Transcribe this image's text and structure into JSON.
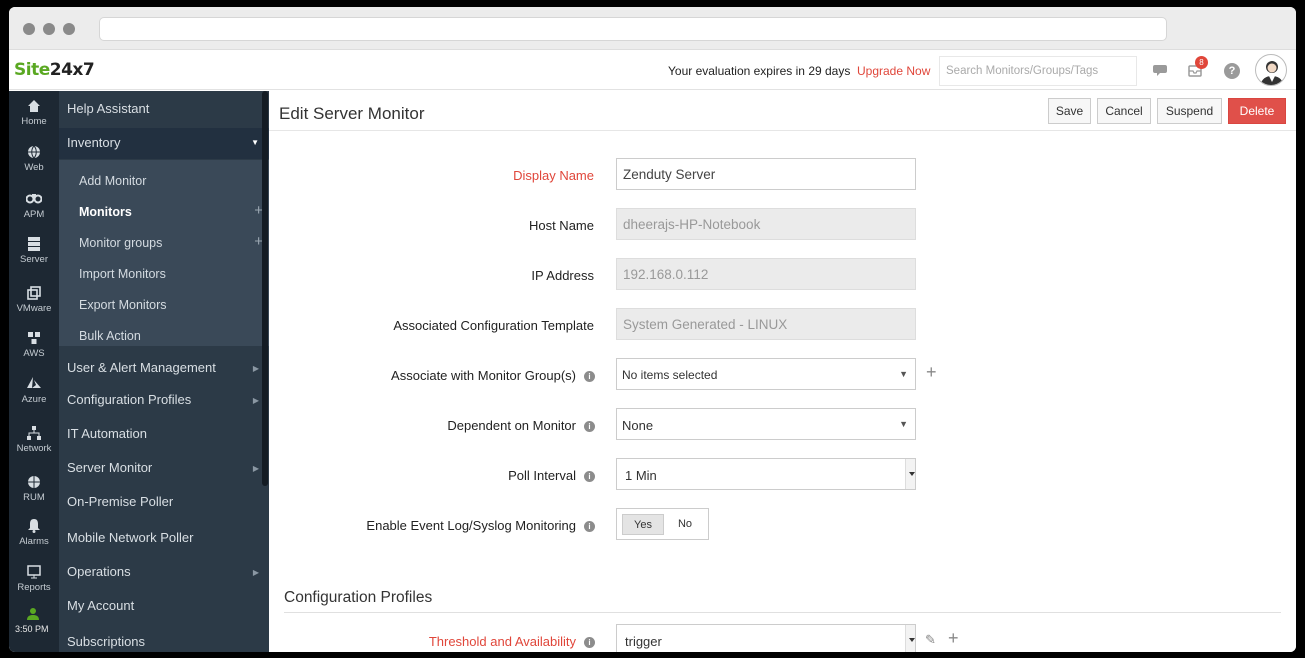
{
  "browser": {
    "url": ""
  },
  "topbar": {
    "logo_site": "Site",
    "logo_num": "24x7",
    "evaluation_text": "Your evaluation expires in 29 days",
    "upgrade_label": "Upgrade Now",
    "search_placeholder": "Search Monitors/Groups/Tags",
    "notification_count": "8"
  },
  "icon_nav": [
    {
      "label": "Home",
      "icon": "home-icon"
    },
    {
      "label": "Web",
      "icon": "globe-icon"
    },
    {
      "label": "APM",
      "icon": "binoculars-icon"
    },
    {
      "label": "Server",
      "icon": "server-icon"
    },
    {
      "label": "VMware",
      "icon": "vmware-icon"
    },
    {
      "label": "AWS",
      "icon": "aws-icon"
    },
    {
      "label": "Azure",
      "icon": "azure-icon"
    },
    {
      "label": "Network",
      "icon": "network-icon"
    },
    {
      "label": "RUM",
      "icon": "rum-globe-icon"
    },
    {
      "label": "Alarms",
      "icon": "bell-icon"
    },
    {
      "label": "Reports",
      "icon": "reports-icon"
    }
  ],
  "clock": "3:50 PM",
  "side_menu": {
    "help_assistant": "Help Assistant",
    "inventory": "Inventory",
    "inventory_items": [
      "Add Monitor",
      "Monitors",
      "Monitor groups",
      "Import Monitors",
      "Export Monitors",
      "Bulk Action"
    ],
    "items": [
      "User & Alert Management",
      "Configuration Profiles",
      "IT Automation",
      "Server Monitor",
      "On-Premise Poller",
      "Mobile Network Poller",
      "Operations",
      "My Account",
      "Subscriptions"
    ]
  },
  "page": {
    "title": "Edit Server Monitor",
    "buttons": {
      "save": "Save",
      "cancel": "Cancel",
      "suspend": "Suspend",
      "delete": "Delete"
    }
  },
  "form": {
    "display_name": {
      "label": "Display Name",
      "value": "Zenduty Server"
    },
    "host_name": {
      "label": "Host Name",
      "value": "dheerajs-HP-Notebook"
    },
    "ip_address": {
      "label": "IP Address",
      "value": "192.168.0.112"
    },
    "config_template": {
      "label": "Associated Configuration Template",
      "value": "System Generated - LINUX"
    },
    "monitor_group": {
      "label": "Associate with Monitor Group(s)",
      "value": "No items selected"
    },
    "dependent": {
      "label": "Dependent on Monitor",
      "value": "None"
    },
    "poll_interval": {
      "label": "Poll Interval",
      "value": "1 Min"
    },
    "event_log": {
      "label": "Enable Event Log/Syslog Monitoring",
      "yes": "Yes",
      "no": "No",
      "selected": "Yes"
    }
  },
  "config_profiles": {
    "section_title": "Configuration Profiles",
    "threshold": {
      "label": "Threshold and Availability",
      "value": "trigger"
    }
  },
  "colors": {
    "accent_red": "#e0463a",
    "logo_green": "#5aa822",
    "sidebar": "#2c3a47",
    "icon_nav": "#1d2833"
  }
}
